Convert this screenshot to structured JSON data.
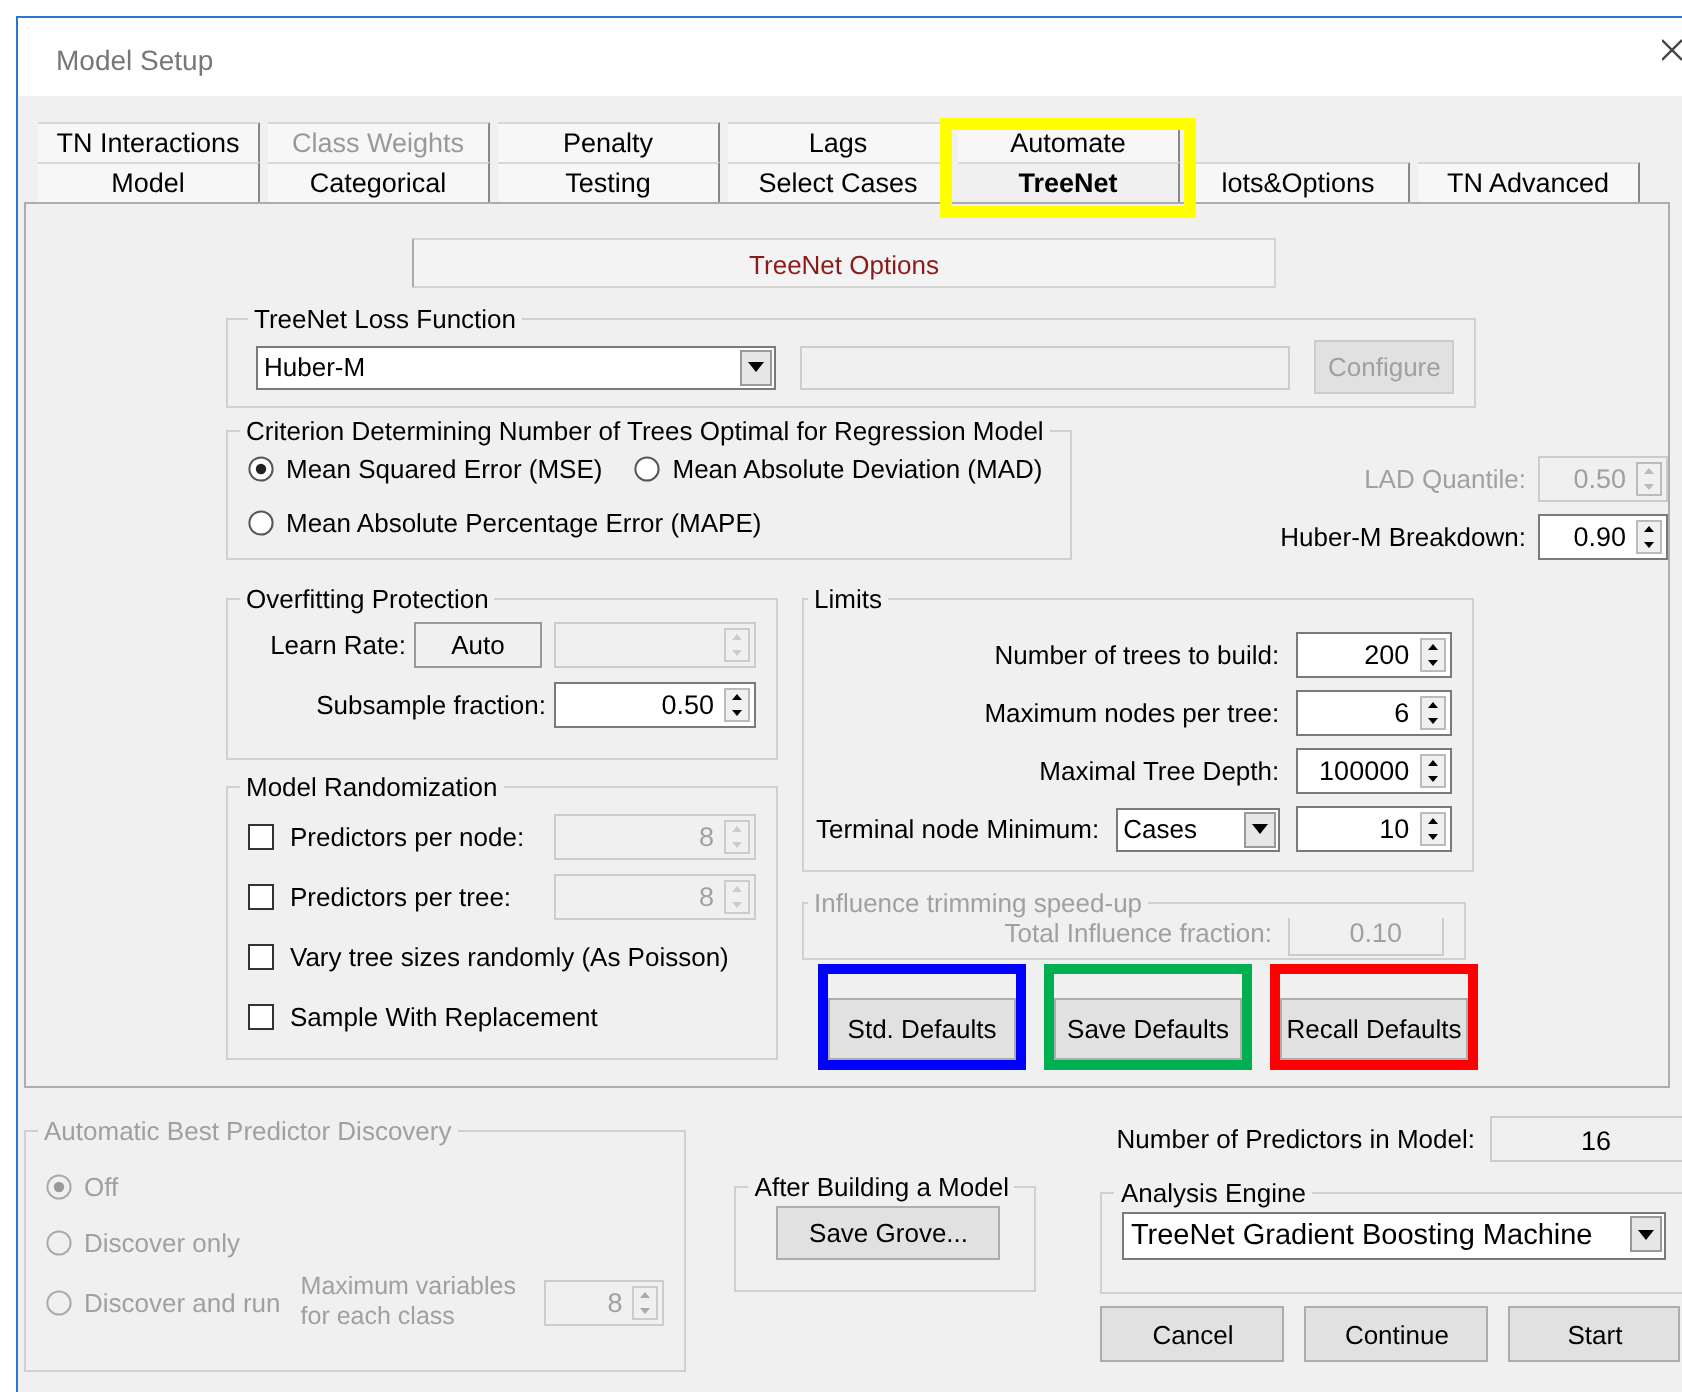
{
  "window": {
    "title": "Model Setup"
  },
  "tabs": {
    "rows": [
      [
        {
          "label": "TN Interactions",
          "selected": false,
          "disabled": false
        },
        {
          "label": "Class Weights",
          "selected": false,
          "disabled": true
        },
        {
          "label": "Penalty",
          "selected": false,
          "disabled": false
        },
        {
          "label": "Lags",
          "selected": false,
          "disabled": false
        },
        {
          "label": "Automate",
          "selected": false,
          "disabled": false
        }
      ],
      [
        {
          "label": "Model",
          "selected": false,
          "disabled": false
        },
        {
          "label": "Categorical",
          "selected": false,
          "disabled": false
        },
        {
          "label": "Testing",
          "selected": false,
          "disabled": false
        },
        {
          "label": "Select Cases",
          "selected": false,
          "disabled": false
        },
        {
          "label": "TreeNet",
          "selected": true,
          "disabled": false
        },
        {
          "label": "lots&Options",
          "selected": false,
          "disabled": false
        },
        {
          "label": "TN Advanced",
          "selected": false,
          "disabled": false
        }
      ]
    ]
  },
  "options_header": "TreeNet Options",
  "loss_function": {
    "title": "TreeNet Loss Function",
    "value": "Huber-M",
    "configure": {
      "label": "Configure",
      "disabled": true
    }
  },
  "criterion": {
    "title": "Criterion Determining Number of Trees Optimal for Regression Model",
    "options": [
      {
        "label": "Mean Squared Error (MSE)",
        "selected": true
      },
      {
        "label": "Mean Absolute Deviation (MAD)",
        "selected": false
      },
      {
        "label": "Mean Absolute Percentage Error (MAPE)",
        "selected": false
      }
    ]
  },
  "lad_quantile": {
    "label": "LAD Quantile:",
    "value": "0.50",
    "disabled": true
  },
  "huber_breakdown": {
    "label": "Huber-M Breakdown:",
    "value": "0.90",
    "disabled": false
  },
  "overfitting": {
    "title": "Overfitting Protection",
    "learn_rate": {
      "label": "Learn Rate:",
      "button": "Auto"
    },
    "subsample": {
      "label": "Subsample fraction:",
      "value": "0.50"
    }
  },
  "randomization": {
    "title": "Model Randomization",
    "items": [
      {
        "label": "Predictors per node:",
        "checked": false,
        "value": "8"
      },
      {
        "label": "Predictors per tree:",
        "checked": false,
        "value": "8"
      },
      {
        "label": "Vary tree sizes randomly (As Poisson)",
        "checked": false
      },
      {
        "label": "Sample With Replacement",
        "checked": false
      }
    ]
  },
  "limits": {
    "title": "Limits",
    "rows": [
      {
        "kind": "spinner",
        "label": "Number of trees to build:",
        "value": "200"
      },
      {
        "kind": "spinner",
        "label": "Maximum nodes per tree:",
        "value": "6"
      },
      {
        "kind": "spinner",
        "label": "Maximal Tree Depth:",
        "value": "100000"
      },
      {
        "kind": "combo",
        "label": "Terminal node Minimum:",
        "choice": "Cases",
        "value": "10"
      }
    ]
  },
  "influence": {
    "title": "Influence trimming speed-up",
    "label": "Total Influence fraction:",
    "value": "0.10",
    "disabled": true
  },
  "default_buttons": [
    {
      "label": "Std. Defaults"
    },
    {
      "label": "Save Defaults"
    },
    {
      "label": "Recall Defaults"
    }
  ],
  "discovery": {
    "title": "Automatic Best Predictor Discovery",
    "disabled": true,
    "options": [
      {
        "label": "Off",
        "selected": true
      },
      {
        "label": "Discover only",
        "selected": false
      },
      {
        "label": "Discover and run",
        "selected": false
      }
    ],
    "max_vars": {
      "label": "Maximum variables for each class",
      "value": "8"
    }
  },
  "after_building": {
    "title": "After Building a Model",
    "button": "Save Grove..."
  },
  "predictors": {
    "label": "Number of Predictors in Model:",
    "value": "16"
  },
  "engine": {
    "title": "Analysis Engine",
    "value": "TreeNet Gradient Boosting Machine"
  },
  "buttons": [
    "Cancel",
    "Continue",
    "Start"
  ]
}
